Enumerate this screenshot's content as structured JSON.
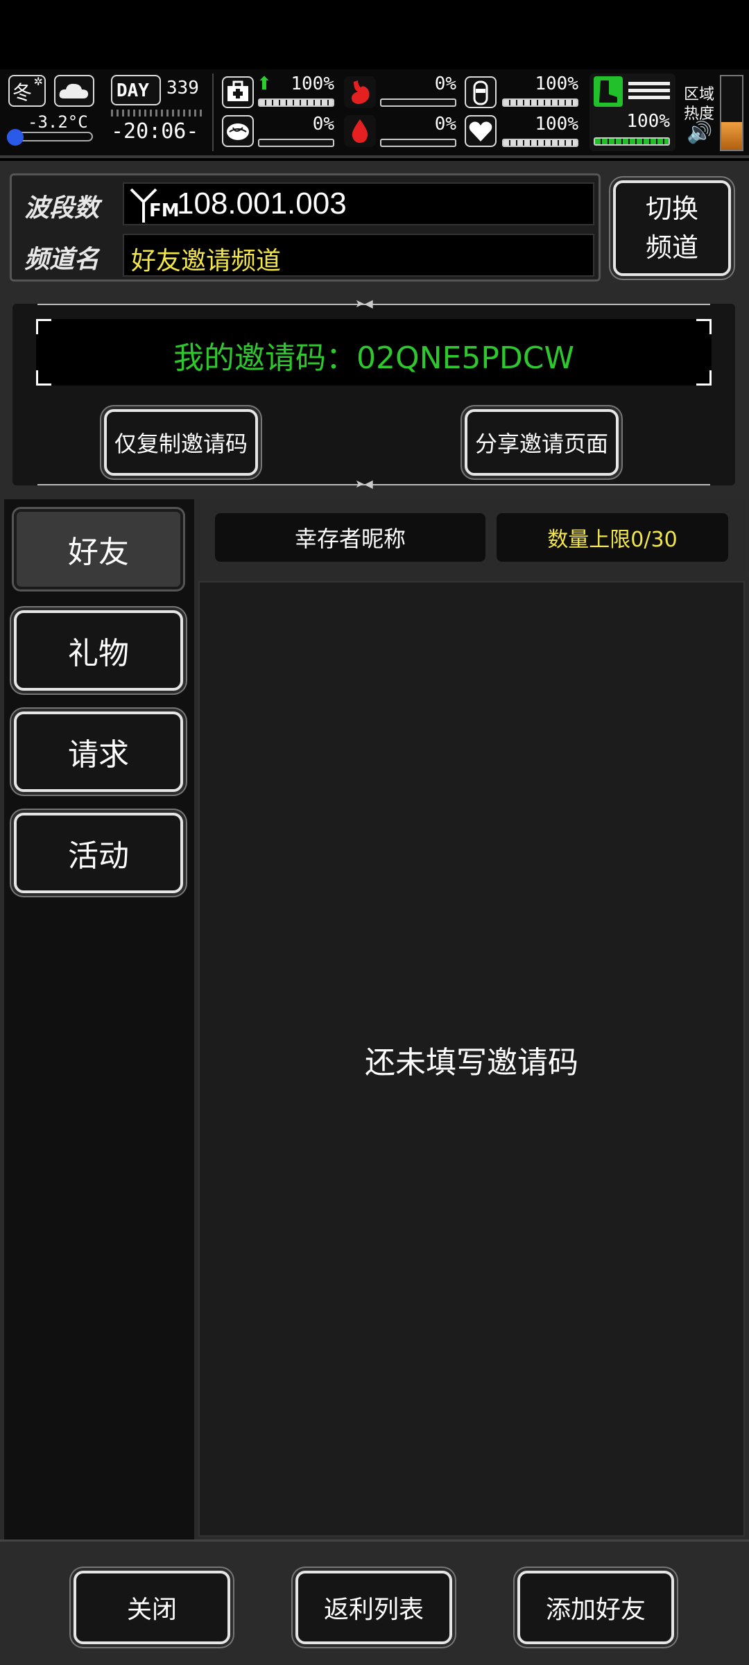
{
  "hud": {
    "season": "冬",
    "temperature": "-3.2°C",
    "day_label": "DAY",
    "day_number": "339",
    "time": "-20:06-",
    "stats": [
      {
        "icon": "medkit-icon",
        "value": "100%",
        "level": 1.0
      },
      {
        "icon": "stomach-icon",
        "value": "0%",
        "level": 0.0
      },
      {
        "icon": "water-bottle-icon",
        "value": "100%",
        "level": 1.0
      },
      {
        "icon": "brain-icon",
        "value": "0%",
        "level": 0.0
      },
      {
        "icon": "blood-drop-icon",
        "value": "0%",
        "level": 0.0
      },
      {
        "icon": "heart-icon",
        "value": "100%",
        "level": 1.0
      }
    ],
    "stamina_value": "100%",
    "region_heat_label_1": "区域",
    "region_heat_label_2": "热度"
  },
  "channel": {
    "band_label": "波段数",
    "band_value": "108.001.003",
    "fm_label": "FM",
    "name_label": "频道名",
    "name_value": "好友邀请频道",
    "switch_button_line1": "切换",
    "switch_button_line2": "频道"
  },
  "invite": {
    "code_text": "我的邀请码：02QNE5PDCW",
    "copy_button": "仅复制邀请码",
    "share_button": "分享邀请页面"
  },
  "tabs": [
    {
      "label": "好友",
      "active": true
    },
    {
      "label": "礼物",
      "active": false
    },
    {
      "label": "请求",
      "active": false
    },
    {
      "label": "活动",
      "active": false
    }
  ],
  "list": {
    "col_name": "幸存者昵称",
    "col_limit": "数量上限0/30",
    "empty_text": "还未填写邀请码"
  },
  "bottom": {
    "close": "关闭",
    "rebate": "返利列表",
    "add_friend": "添加好友"
  },
  "colors": {
    "code_green": "#2ec82e",
    "channel_name_yellow": "#f2e64a",
    "limit_yellow": "#f2e64a",
    "stamina_green": "#22c02a"
  }
}
